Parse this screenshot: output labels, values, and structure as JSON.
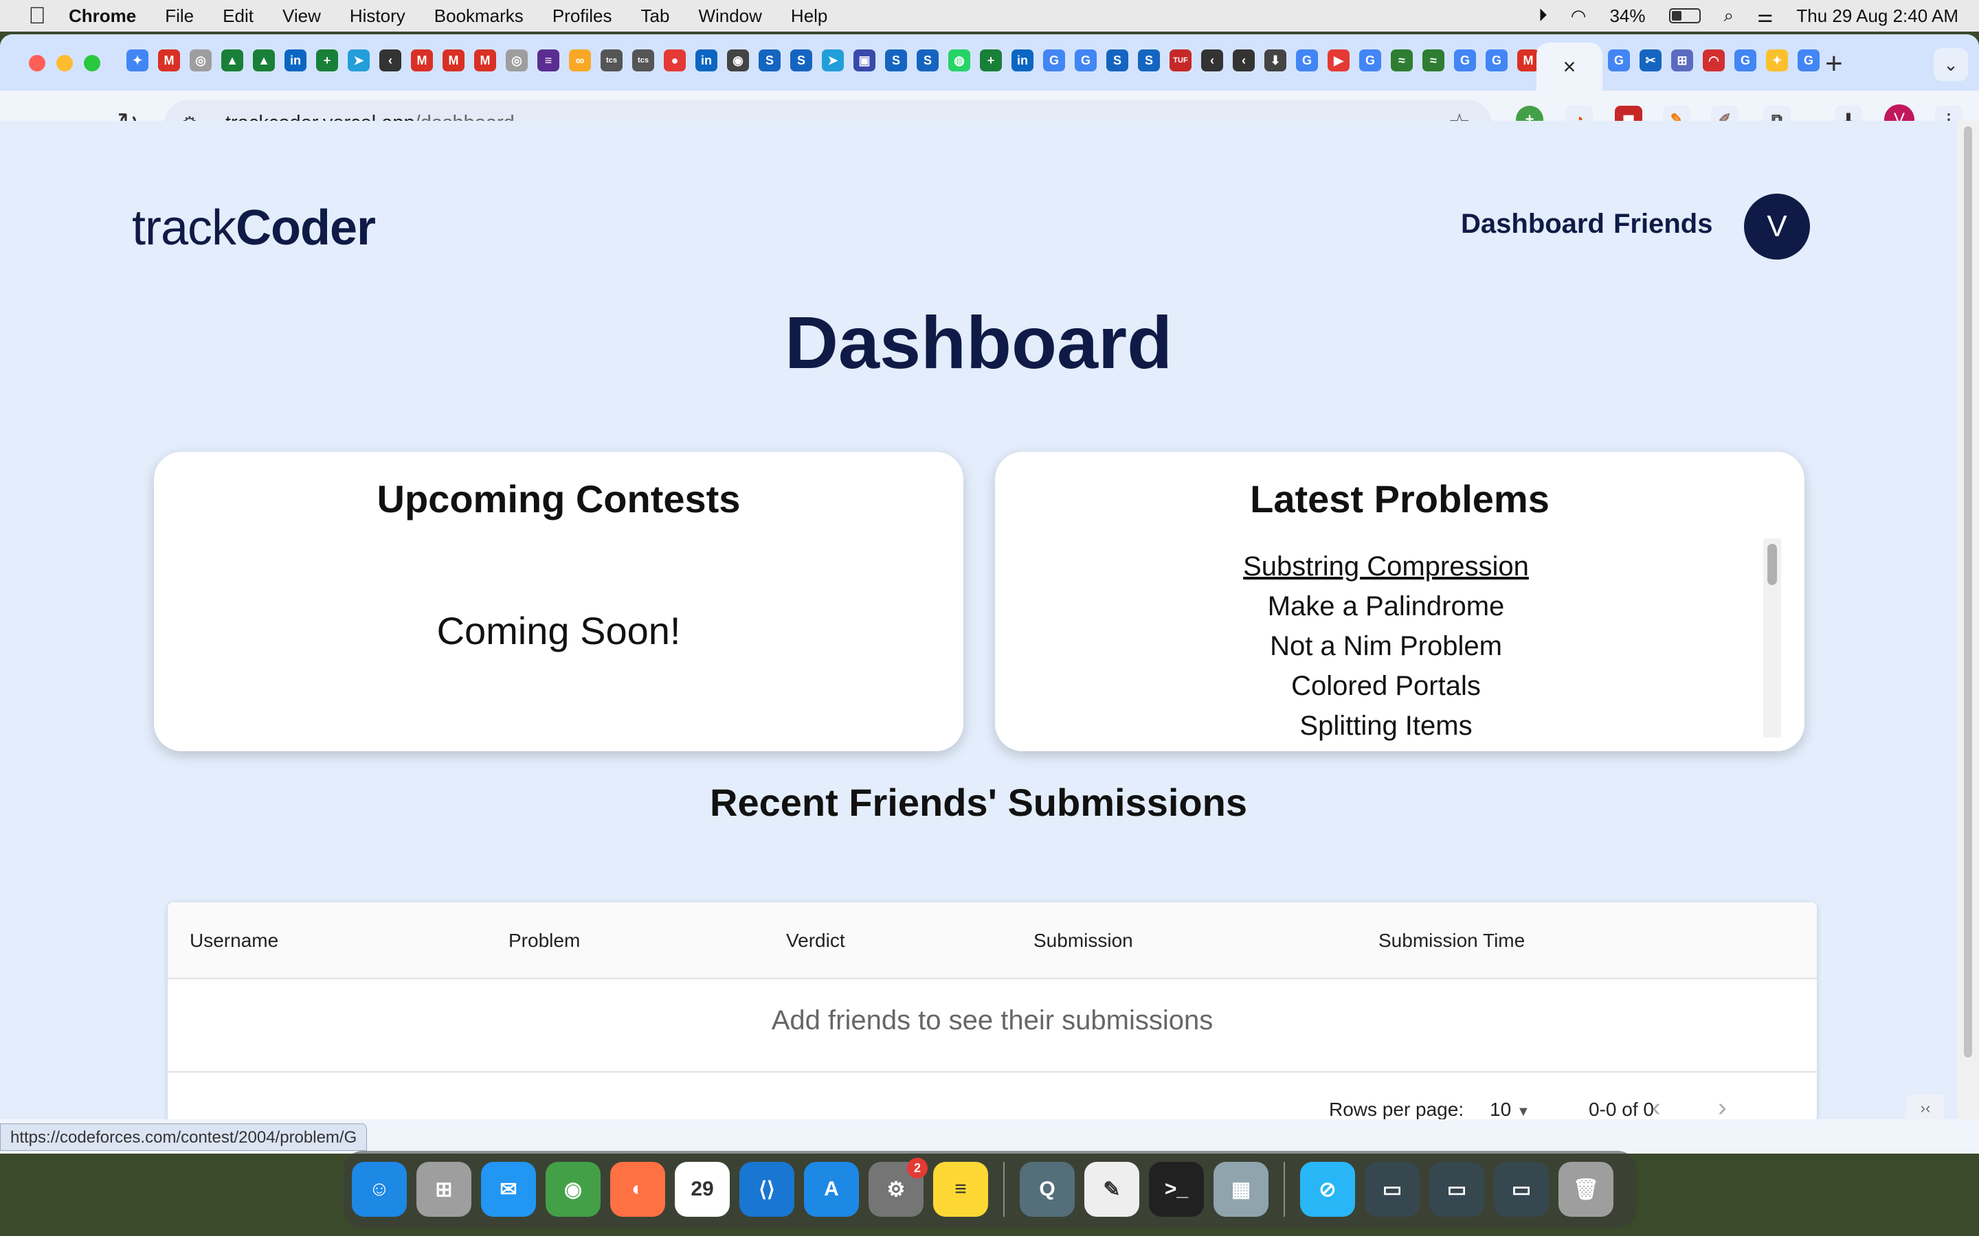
{
  "menubar": {
    "app": "Chrome",
    "items": [
      "File",
      "Edit",
      "View",
      "History",
      "Bookmarks",
      "Profiles",
      "Tab",
      "Window",
      "Help"
    ],
    "battery": "34%",
    "datetime": "Thu 29 Aug  2:40 AM"
  },
  "browser": {
    "url_host": "trackcoder.vercel.app",
    "url_path": "/dashboard",
    "active_tab_close": "×",
    "profile_initial": "V",
    "tab_favicons": [
      {
        "g": "✦",
        "c": "#4285f4"
      },
      {
        "g": "M",
        "c": "#d93025"
      },
      {
        "g": "◎",
        "c": "#9e9e9e"
      },
      {
        "g": "▲",
        "c": "#188038"
      },
      {
        "g": "▲",
        "c": "#188038"
      },
      {
        "g": "in",
        "c": "#0a66c2"
      },
      {
        "g": "+",
        "c": "#188038"
      },
      {
        "g": "➤",
        "c": "#229ed9"
      },
      {
        "g": "‹",
        "c": "#333333"
      },
      {
        "g": "M",
        "c": "#d93025"
      },
      {
        "g": "M",
        "c": "#d93025"
      },
      {
        "g": "M",
        "c": "#d93025"
      },
      {
        "g": "◎",
        "c": "#9e9e9e"
      },
      {
        "g": "≡",
        "c": "#5c2d91"
      },
      {
        "g": "∞",
        "c": "#f9a825"
      },
      {
        "g": "tcs",
        "c": "#555555"
      },
      {
        "g": "tcs",
        "c": "#555555"
      },
      {
        "g": "●",
        "c": "#e53935"
      },
      {
        "g": "in",
        "c": "#0a66c2"
      },
      {
        "g": "◉",
        "c": "#444444"
      },
      {
        "g": "S",
        "c": "#1565c0"
      },
      {
        "g": "S",
        "c": "#1565c0"
      },
      {
        "g": "➤",
        "c": "#229ed9"
      },
      {
        "g": "▣",
        "c": "#3949ab"
      },
      {
        "g": "S",
        "c": "#1565c0"
      },
      {
        "g": "S",
        "c": "#1565c0"
      },
      {
        "g": "◍",
        "c": "#25d366"
      },
      {
        "g": "+",
        "c": "#188038"
      },
      {
        "g": "in",
        "c": "#0a66c2"
      },
      {
        "g": "G",
        "c": "#4285f4"
      },
      {
        "g": "G",
        "c": "#4285f4"
      },
      {
        "g": "S",
        "c": "#1565c0"
      },
      {
        "g": "S",
        "c": "#1565c0"
      },
      {
        "g": "TUF",
        "c": "#c62828"
      },
      {
        "g": "‹",
        "c": "#333333"
      },
      {
        "g": "‹",
        "c": "#333333"
      },
      {
        "g": "⬇",
        "c": "#444444"
      },
      {
        "g": "G",
        "c": "#4285f4"
      },
      {
        "g": "▶",
        "c": "#e53935"
      },
      {
        "g": "G",
        "c": "#4285f4"
      },
      {
        "g": "≈",
        "c": "#2e7d32"
      },
      {
        "g": "≈",
        "c": "#2e7d32"
      },
      {
        "g": "G",
        "c": "#4285f4"
      },
      {
        "g": "G",
        "c": "#4285f4"
      },
      {
        "g": "M",
        "c": "#d93025"
      }
    ],
    "after_tabs": [
      {
        "g": "G",
        "c": "#4285f4"
      },
      {
        "g": "✂",
        "c": "#1565c0"
      },
      {
        "g": "⊞",
        "c": "#5c6bc0"
      },
      {
        "g": "◠",
        "c": "#d32f2f"
      },
      {
        "g": "G",
        "c": "#4285f4"
      },
      {
        "g": "✦",
        "c": "#fbc02d"
      },
      {
        "g": "G",
        "c": "#4285f4"
      }
    ]
  },
  "site": {
    "brand_light": "track",
    "brand_bold": "Coder",
    "nav": [
      "Dashboard",
      "Friends"
    ],
    "avatar_initial": "V",
    "page_title": "Dashboard",
    "upcoming": {
      "title": "Upcoming Contests",
      "message": "Coming Soon!"
    },
    "latest": {
      "title": "Latest Problems",
      "problems": [
        "Substring Compression",
        "Make a Palindrome",
        "Not a Nim Problem",
        "Colored Portals",
        "Splitting Items"
      ]
    },
    "submissions": {
      "title": "Recent Friends' Submissions",
      "columns": [
        "Username",
        "Problem",
        "Verdict",
        "Submission",
        "Submission Time"
      ],
      "empty_message": "Add friends to see their submissions",
      "rows_per_page_label": "Rows per page:",
      "rows_per_page_value": "10",
      "range": "0-0 of 0"
    }
  },
  "status_url": "https://codeforces.com/contest/2004/problem/G",
  "dock": {
    "apps": [
      {
        "name": "Finder",
        "g": "☺",
        "c": "#1e88e5"
      },
      {
        "name": "Launchpad",
        "g": "⊞",
        "c": "#9e9e9e"
      },
      {
        "name": "Mail",
        "g": "✉",
        "c": "#2196f3"
      },
      {
        "name": "Chrome",
        "g": "◉",
        "c": "#43a047"
      },
      {
        "name": "Firefox",
        "g": "◐",
        "c": "#ff7043"
      },
      {
        "name": "Calendar",
        "g": "29",
        "c": "#ffffff"
      },
      {
        "name": "VS Code",
        "g": "⟨⟩",
        "c": "#1976d2"
      },
      {
        "name": "App Store",
        "g": "A",
        "c": "#1e88e5"
      },
      {
        "name": "System Settings",
        "g": "⚙",
        "c": "#757575",
        "badge": "2"
      },
      {
        "name": "Notes",
        "g": "≡",
        "c": "#fdd835"
      }
    ],
    "apps2": [
      {
        "name": "QuickTime",
        "g": "Q",
        "c": "#546e7a"
      },
      {
        "name": "TextEdit",
        "g": "✎",
        "c": "#eeeeee"
      },
      {
        "name": "Terminal",
        "g": ">_",
        "c": "#212121"
      },
      {
        "name": "Preview",
        "g": "▦",
        "c": "#90a4ae"
      }
    ],
    "apps3": [
      {
        "name": "Safari",
        "g": "⊘",
        "c": "#29b6f6"
      },
      {
        "name": "Window 1",
        "g": "▭",
        "c": "#37474f"
      },
      {
        "name": "Window 2",
        "g": "▭",
        "c": "#37474f"
      },
      {
        "name": "Window 3",
        "g": "▭",
        "c": "#37474f"
      },
      {
        "name": "Trash",
        "g": "🗑",
        "c": "#9e9e9e"
      }
    ]
  }
}
